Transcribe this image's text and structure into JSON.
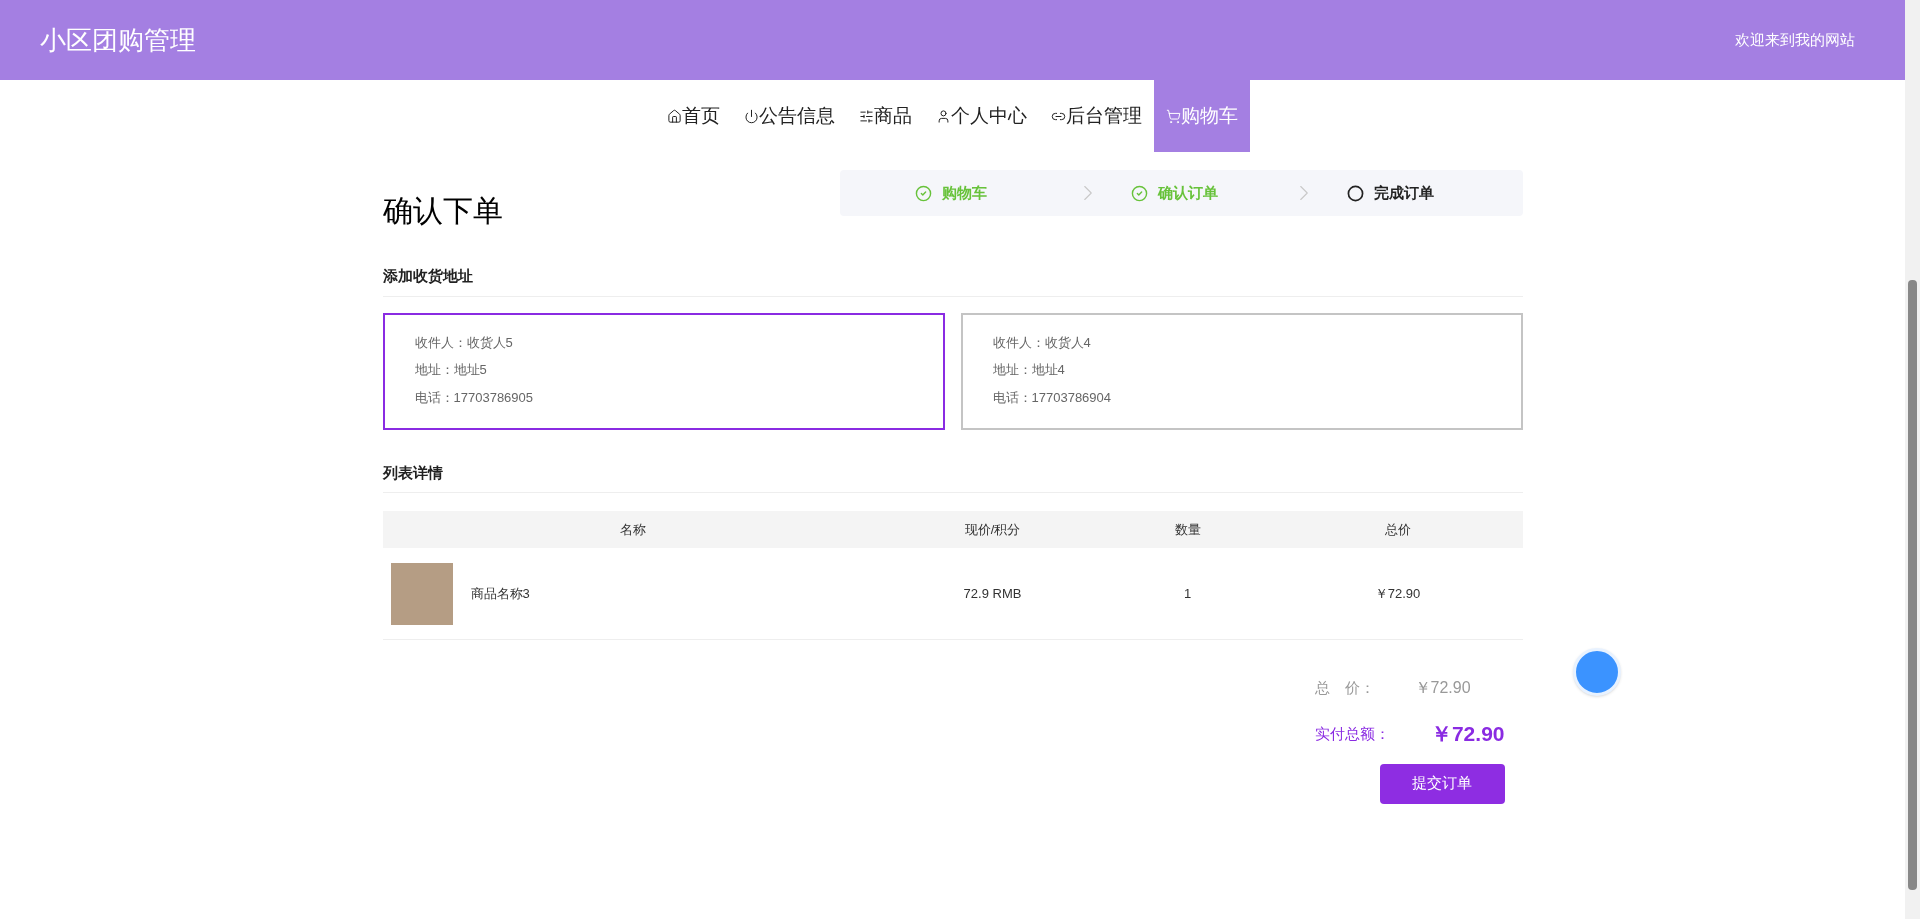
{
  "header": {
    "title": "小区团购管理",
    "welcome": "欢迎来到我的网站"
  },
  "nav": [
    {
      "label": "首页",
      "selected": false
    },
    {
      "label": "公告信息",
      "selected": false
    },
    {
      "label": "商品",
      "selected": false
    },
    {
      "label": "个人中心",
      "selected": false
    },
    {
      "label": "后台管理",
      "selected": false
    },
    {
      "label": "购物车",
      "selected": true
    }
  ],
  "page_title": "确认下单",
  "steps": [
    {
      "label": "购物车",
      "done": true
    },
    {
      "label": "确认订单",
      "done": true
    },
    {
      "label": "完成订单",
      "done": false
    }
  ],
  "address_section": {
    "title": "添加收货地址",
    "addresses": [
      {
        "lines": [
          "收件人：收货人5",
          "地址：地址5",
          "电话：17703786905"
        ],
        "selected": true
      },
      {
        "lines": [
          "收件人：收货人4",
          "地址：地址4",
          "电话：17703786904"
        ],
        "selected": false
      }
    ]
  },
  "list_section": {
    "title": "列表详情",
    "columns": [
      "名称",
      "现价/积分",
      "数量",
      "总价"
    ],
    "rows": [
      {
        "name": "商品名称3",
        "price": "72.9 RMB",
        "quantity": "1",
        "total": "￥72.90"
      }
    ]
  },
  "summary": {
    "total_label": "总　价：",
    "total": "￥72.90",
    "paid_label": "实付总额：",
    "paid": "￥72.90",
    "submit": "提交订单"
  }
}
